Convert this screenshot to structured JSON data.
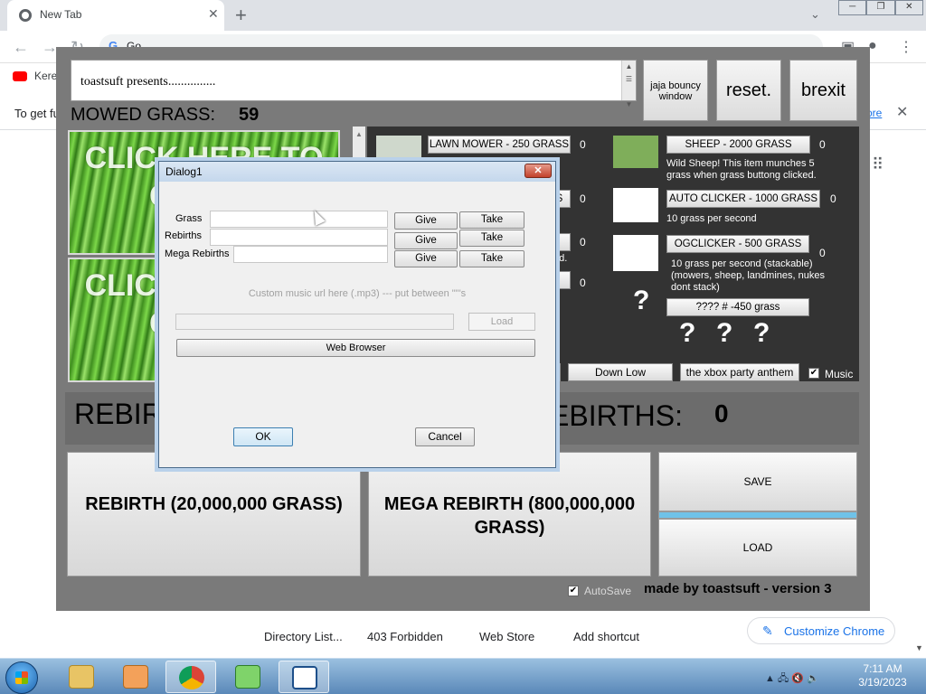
{
  "browser": {
    "tab_title": "New Tab",
    "omnibox_text": "Go",
    "bookmark_label": "Kere",
    "infobar_text": "To get fu",
    "infobar_link": "ore",
    "window_controls": [
      "─",
      "❐",
      "✕"
    ]
  },
  "ntp": {
    "shortcuts": [
      "Directory List...",
      "403 Forbidden",
      "Web Store",
      "Add shortcut"
    ],
    "customize_label": "Customize Chrome"
  },
  "game": {
    "presents_text": "toastsuft presents...............",
    "jaja_label": "jaja bouncy window",
    "reset_label": "reset.",
    "brexit_label": "brexit",
    "mowed_label": "MOWED GRASS:",
    "mowed_value": "59",
    "grass_button_text": "CLICK HERE TO GRASS",
    "shop": {
      "lawn_mower": {
        "label": "LAWN MOWER - 250 GRASS",
        "count": "0"
      },
      "hidden_item_1": {
        "label": "S",
        "count": "0"
      },
      "hidden_item_2": {
        "label": "",
        "count": "0",
        "desc": "ed."
      },
      "hidden_item_3": {
        "label": "",
        "count": "0"
      },
      "sheep": {
        "label": "SHEEP - 2000 GRASS",
        "count": "0",
        "desc": "Wild Sheep! This item munches 5 grass when grass buttong clicked."
      },
      "auto_clicker": {
        "label": "AUTO CLICKER - 1000 GRASS",
        "count": "0",
        "desc": "10 grass per second"
      },
      "ogclicker": {
        "label": "OGCLICKER - 500 GRASS",
        "count": "0",
        "desc": "10 grass per second (stackable) (mowers, sheep, landmines, nukes dont stack)"
      },
      "mystery": {
        "label": "???? # -450 grass",
        "q": "?"
      },
      "bottom_q": [
        "?",
        "?",
        "?"
      ]
    },
    "music": {
      "btn_down_low": "Down Low",
      "btn_xbox": "the xbox party anthem",
      "music_label": "Music",
      "checked_glyph": "✔"
    },
    "rebirth_label": "REBIR",
    "megarebirths_label": "EBIRTHS:",
    "megarebirths_value": "0",
    "rebirth_button": "REBIRTH (20,000,000 GRASS)",
    "megarebirth_button": "MEGA REBIRTH (800,000,000 GRASS)",
    "save_label": "SAVE",
    "load_label": "LOAD",
    "autosave_label": "AutoSave",
    "credit": "made by toastsuft - version 3"
  },
  "dialog": {
    "title": "Dialog1",
    "close_glyph": "✕",
    "rows": [
      {
        "label": "Grass",
        "value": "",
        "give": "Give",
        "take": "Take"
      },
      {
        "label": "Rebirths",
        "value": "",
        "give": "Give",
        "take": "Take"
      },
      {
        "label": "Mega Rebirths",
        "value": "",
        "give": "Give",
        "take": "Take"
      }
    ],
    "music_hint": "Custom music url here (.mp3) --- put between \"\"'s",
    "load_label": "Load",
    "web_browser_label": "Web Browser",
    "ok_label": "OK",
    "cancel_label": "Cancel"
  },
  "taskbar": {
    "time": "7:11 AM",
    "date": "3/19/2023",
    "tray_glyphs": "▲ 🖧 🔇 🔈"
  },
  "colors": {
    "game_bg": "#7a7a7a",
    "shop_bg": "#333333",
    "dialog_bg": "#f0f0f0",
    "accent_blue": "#1a73e8"
  }
}
